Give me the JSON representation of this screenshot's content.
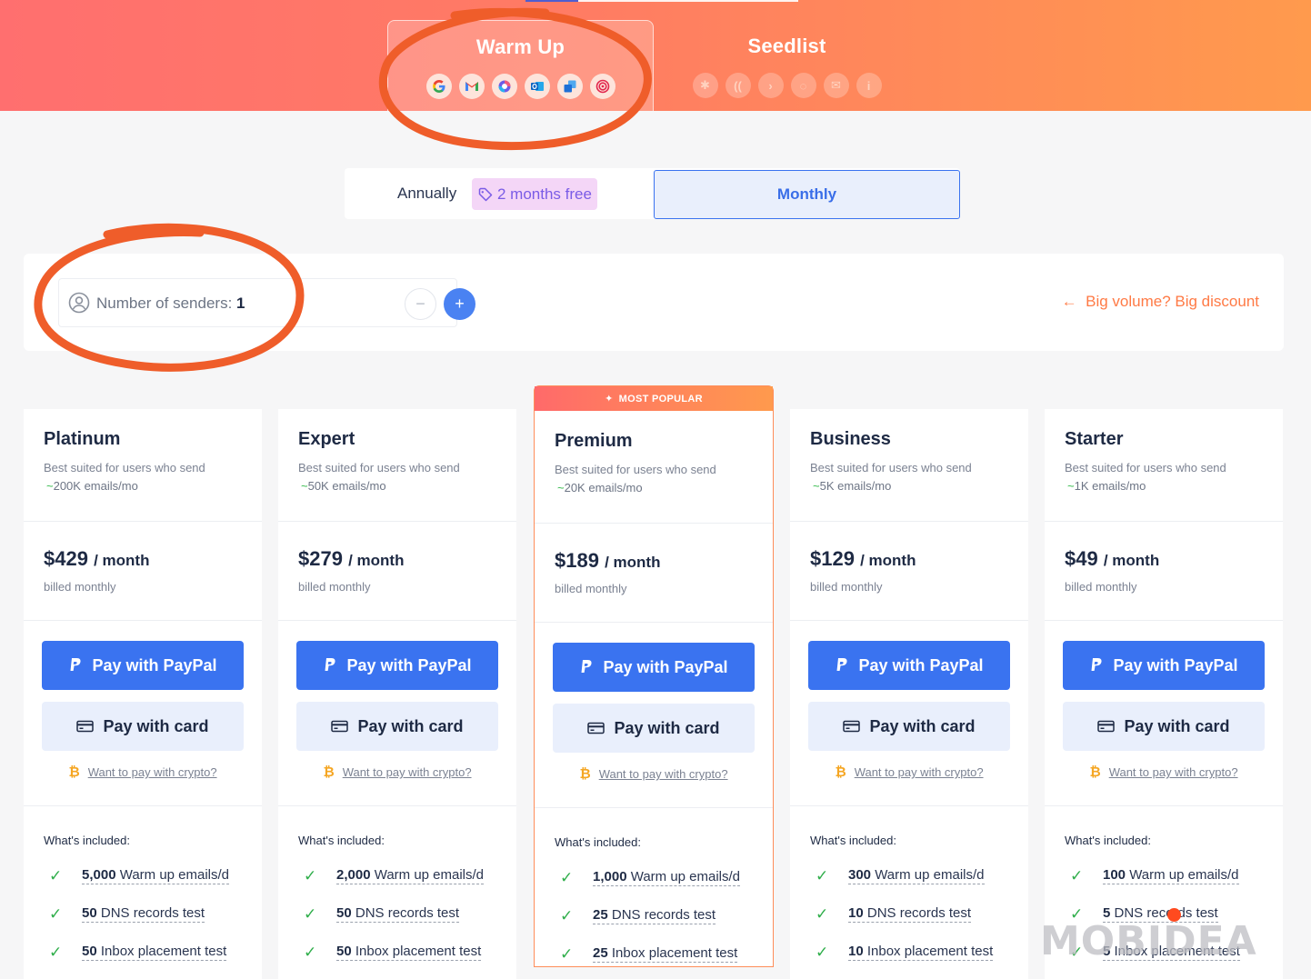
{
  "header": {
    "tabs": [
      {
        "label": "Warm Up",
        "icons": [
          "google-icon",
          "gmail-icon",
          "microsoft365-icon",
          "outlook-icon",
          "exchange-icon",
          "target-icon"
        ]
      },
      {
        "label": "Seedlist",
        "icons": [
          "hubspot-icon",
          "yahoo-icon",
          "forward-icon",
          "spinner-icon",
          "mail-icon",
          "info-icon"
        ]
      }
    ]
  },
  "billing": {
    "annually_label": "Annually",
    "discount_badge": "2 months free",
    "monthly_label": "Monthly"
  },
  "senders": {
    "label": "Number of senders:",
    "count": "1",
    "minus": "−",
    "plus": "+",
    "big_volume": "Big volume? Big discount"
  },
  "popular_label": "MOST POPULAR",
  "common": {
    "desc_prefix": "Best suited for users who send",
    "per": "/ month",
    "billed": "billed monthly",
    "paypal": "Pay with PayPal",
    "card": "Pay with card",
    "crypto": "Want to pay with crypto?",
    "included": "What's included:",
    "f1": "Warm up emails/d",
    "f2": "DNS records test",
    "f3": "Inbox placement test"
  },
  "plans": [
    {
      "name": "Platinum",
      "vol": "200K emails/mo",
      "price": "$429",
      "warm": "5,000",
      "dns": "50",
      "inbox": "50"
    },
    {
      "name": "Expert",
      "vol": "50K emails/mo",
      "price": "$279",
      "warm": "2,000",
      "dns": "50",
      "inbox": "50"
    },
    {
      "name": "Premium",
      "vol": "20K emails/mo",
      "price": "$189",
      "warm": "1,000",
      "dns": "25",
      "inbox": "25"
    },
    {
      "name": "Business",
      "vol": "5K emails/mo",
      "price": "$129",
      "warm": "300",
      "dns": "10",
      "inbox": "10"
    },
    {
      "name": "Starter",
      "vol": "1K emails/mo",
      "price": "$49",
      "warm": "100",
      "dns": "5",
      "inbox": "5"
    }
  ],
  "watermark": "MOBIDEA",
  "colors": {
    "accent": "#3a73f0",
    "orange": "#ff7a45",
    "check": "#2fae4a"
  }
}
